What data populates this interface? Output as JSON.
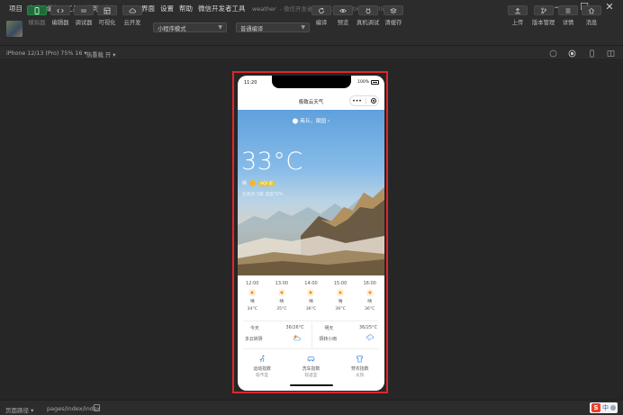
{
  "menubar": {
    "items": [
      "项目",
      "文件",
      "编辑",
      "工具",
      "转到",
      "选择",
      "视图",
      "界面",
      "设置",
      "帮助",
      "微信开发者工具"
    ],
    "window_title": "weather",
    "window_subtitle": "- 微信开发者工具 Stable 1.06.2412050"
  },
  "toolbar": {
    "simulator_label": "模拟器",
    "editor_label": "编辑器",
    "debugger_label": "调试器",
    "visual_label": "可视化",
    "cloud_label": "云开发",
    "mode_select": "小程序模式",
    "compile_select": "普通编译",
    "compile_label": "编译",
    "preview_label": "预览",
    "remote_debug_label": "真机调试",
    "clear_cache_label": "清缓存",
    "upload_label": "上传",
    "version_label": "版本管理",
    "detail_label": "详情",
    "message_label": "消息"
  },
  "subbar": {
    "device": "iPhone 12/13 (Pro) 75% 16 ▾",
    "hot_reload": "热重载 开 ▾"
  },
  "phone": {
    "time": "11:20",
    "battery": "100%",
    "nav_title": "极致云天气",
    "location": "商丘，梁园 ›",
    "temperature": "33°C",
    "condition": "晴",
    "aqi": "AQI 良",
    "detail": "东南风 3级  湿度70%",
    "hourly": [
      {
        "time": "12:00",
        "cond": "晴",
        "temp": "34°C"
      },
      {
        "time": "13:00",
        "cond": "晴",
        "temp": "35°C"
      },
      {
        "time": "14:00",
        "cond": "晴",
        "temp": "36°C"
      },
      {
        "time": "15:00",
        "cond": "晴",
        "temp": "36°C"
      },
      {
        "time": "16:00",
        "cond": "晴",
        "temp": "36°C"
      }
    ],
    "today": {
      "label": "今天",
      "range": "36/26°C",
      "cond": "多云转阴"
    },
    "tomorrow": {
      "label": "明天",
      "range": "36/25°C",
      "cond": "阴转小雨"
    },
    "tips": [
      {
        "name": "运动指数",
        "value": "较不宜"
      },
      {
        "name": "洗车指数",
        "value": "较适宜"
      },
      {
        "name": "穿衣指数",
        "value": "炎热"
      }
    ]
  },
  "statusbar": {
    "path_label": "页面路径 ▾",
    "path": "pages/index/index"
  },
  "ime": {
    "logo": "S",
    "lang": "中"
  }
}
